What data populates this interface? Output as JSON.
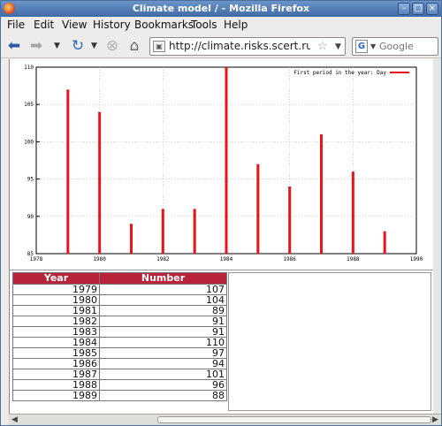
{
  "window": {
    "title": "Climate model / - Mozilla Firefox",
    "buttons": {
      "minimize": "–",
      "maximize": "□",
      "close": "×"
    }
  },
  "menu": [
    "File",
    "Edit",
    "View",
    "History",
    "Bookmarks",
    "Tools",
    "Help"
  ],
  "navigation": {
    "url": "http://climate.risks.scert.ru/rean",
    "search_placeholder": "Google",
    "search_engine_letter": "G",
    "icons": [
      "back-arrow-icon",
      "forward-arrow-icon",
      "reload-icon",
      "stop-icon",
      "home-icon",
      "star-icon"
    ]
  },
  "chart_data": {
    "type": "bar",
    "x": [
      1979,
      1980,
      1981,
      1982,
      1983,
      1984,
      1985,
      1986,
      1987,
      1988,
      1989
    ],
    "series": [
      {
        "name": "First period in the year: Day",
        "values": [
          107,
          104,
          89,
          91,
          91,
          110,
          97,
          94,
          101,
          96,
          88
        ],
        "color": "#e8141a"
      }
    ],
    "xlim": [
      1978,
      1990
    ],
    "ylim": [
      85,
      110
    ],
    "xticks": [
      "1978",
      "1980",
      "1982",
      "1984",
      "1986",
      "1988",
      "1990"
    ],
    "yticks": [
      "85",
      "90",
      "95",
      "100",
      "105",
      "110"
    ],
    "grid": true,
    "legend_position": "top-right"
  },
  "table": {
    "headers": [
      "Year",
      "Number"
    ],
    "header_color": "#b8233a",
    "rows": [
      [
        "1979",
        "107"
      ],
      [
        "1980",
        "104"
      ],
      [
        "1981",
        "89"
      ],
      [
        "1982",
        "91"
      ],
      [
        "1983",
        "91"
      ],
      [
        "1984",
        "110"
      ],
      [
        "1985",
        "97"
      ],
      [
        "1986",
        "94"
      ],
      [
        "1987",
        "101"
      ],
      [
        "1988",
        "96"
      ],
      [
        "1989",
        "88"
      ]
    ]
  }
}
